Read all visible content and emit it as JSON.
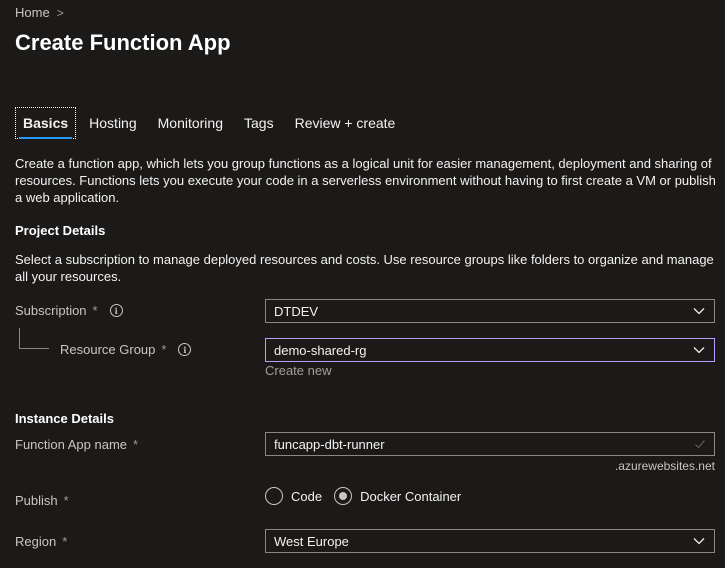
{
  "breadcrumb": {
    "home": "Home",
    "separator": ">"
  },
  "page_title": "Create Function App",
  "tabs": [
    {
      "label": "Basics",
      "active": true
    },
    {
      "label": "Hosting",
      "active": false
    },
    {
      "label": "Monitoring",
      "active": false
    },
    {
      "label": "Tags",
      "active": false
    },
    {
      "label": "Review + create",
      "active": false
    }
  ],
  "description": "Create a function app, which lets you group functions as a logical unit for easier management, deployment and sharing of resources. Functions lets you execute your code in a serverless environment without having to first create a VM or publish a web application.",
  "project_details": {
    "heading": "Project Details",
    "description": "Select a subscription to manage deployed resources and costs. Use resource groups like folders to organize and manage all your resources.",
    "subscription": {
      "label": "Subscription",
      "required": "*",
      "value": "DTDEV"
    },
    "resource_group": {
      "label": "Resource Group",
      "required": "*",
      "value": "demo-shared-rg",
      "create_new": "Create new"
    }
  },
  "instance_details": {
    "heading": "Instance Details",
    "function_app_name": {
      "label": "Function App name",
      "required": "*",
      "value": "funcapp-dbt-runner",
      "suffix": ".azurewebsites.net"
    },
    "publish": {
      "label": "Publish",
      "required": "*",
      "options": [
        "Code",
        "Docker Container"
      ],
      "selected": "Docker Container"
    },
    "region": {
      "label": "Region",
      "required": "*",
      "value": "West Europe"
    }
  },
  "colors": {
    "background": "#1b1a19",
    "accent_tab": "#2899f5",
    "focus_border": "#b4a0ff",
    "border": "#8a8886"
  }
}
